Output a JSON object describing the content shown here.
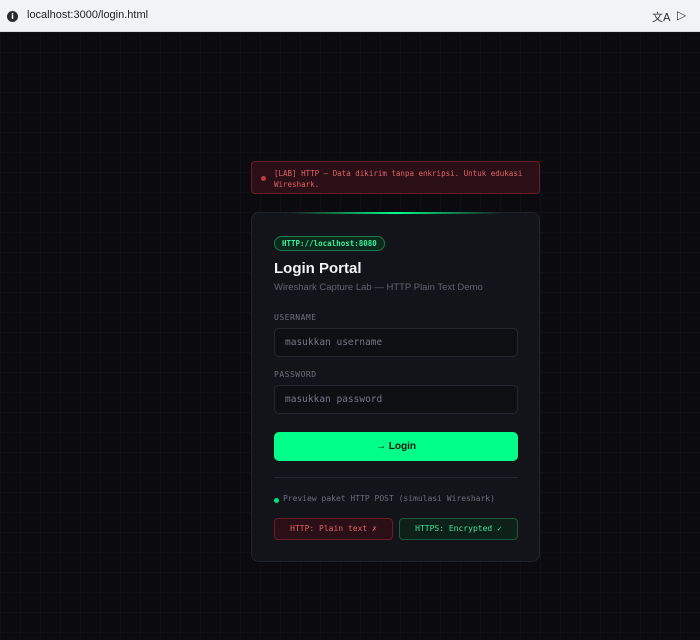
{
  "browser": {
    "url": "localhost:3000/login.html"
  },
  "banner": {
    "text": "[LAB] HTTP — Data dikirim tanpa enkripsi. Untuk edukasi Wireshark."
  },
  "card": {
    "badge": "HTTP://localhost:8080",
    "title": "Login Portal",
    "subtitle": "Wireshark Capture Lab — HTTP Plain Text Demo",
    "username_label": "USERNAME",
    "username_placeholder": "masukkan username",
    "username_value": "",
    "password_label": "PASSWORD",
    "password_placeholder": "masukkan password",
    "password_value": "",
    "login_label": "→ Login",
    "preview_text": "Preview paket HTTP POST (simulasi Wireshark)",
    "http_status": "HTTP: Plain text ✗",
    "https_status": "HTTPS: Encrypted ✓"
  },
  "icons": {
    "site_info": "info-icon",
    "translate": "translate-icon",
    "send": "send-icon"
  },
  "colors": {
    "accent": "#00ff88",
    "danger": "#e06167",
    "background": "#0b0b0f"
  }
}
